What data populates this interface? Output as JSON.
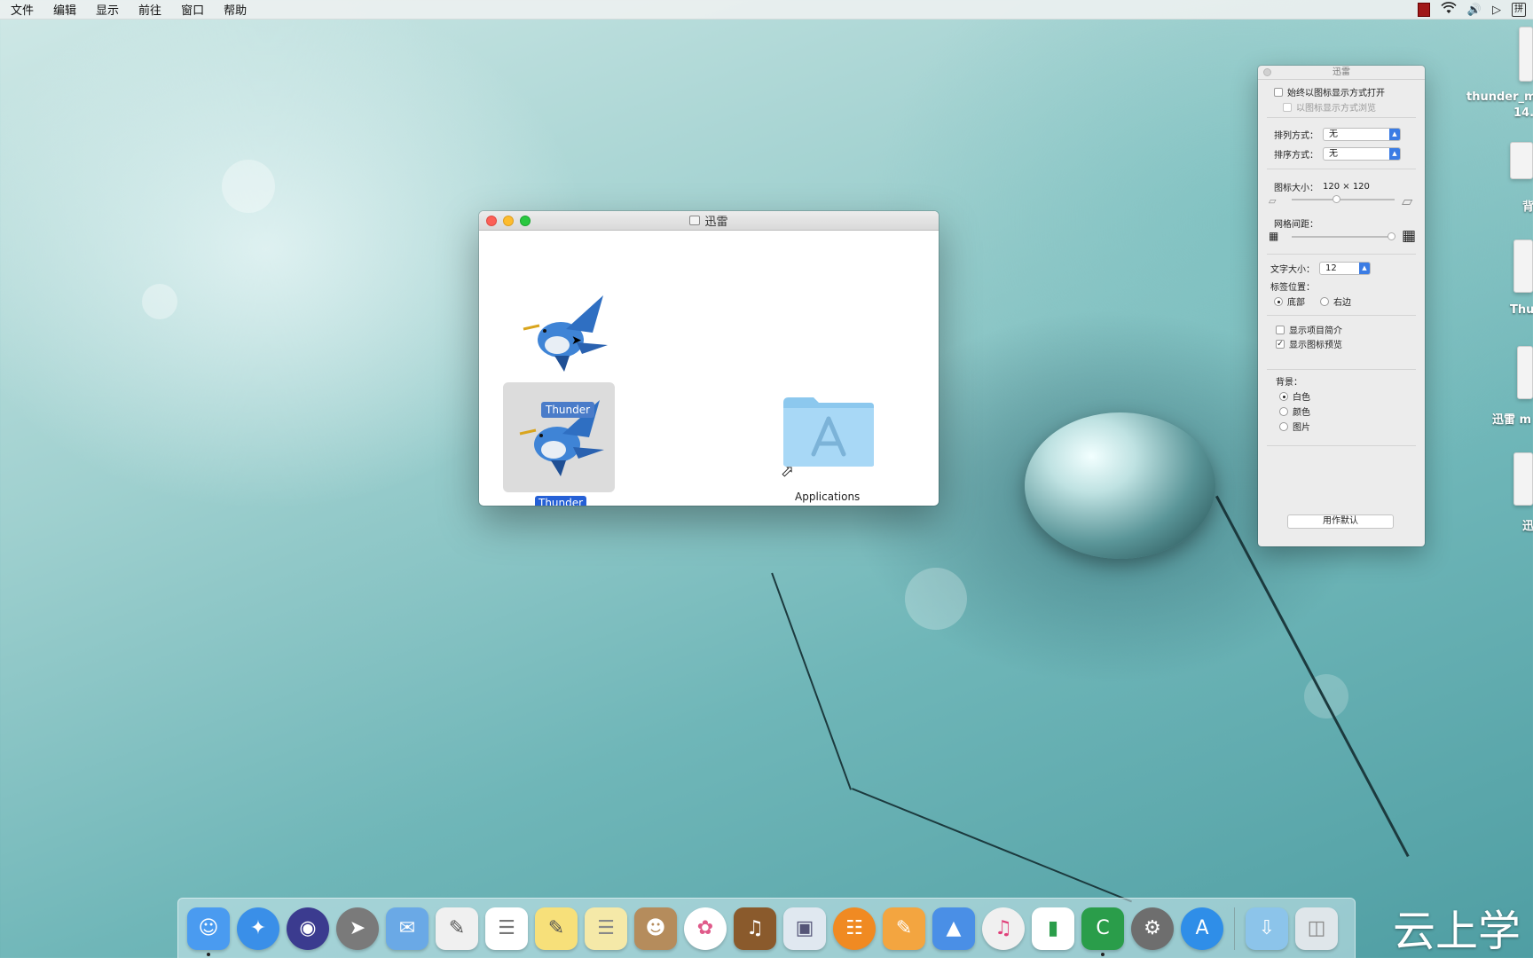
{
  "menubar": {
    "items": [
      "文件",
      "编辑",
      "显示",
      "前往",
      "窗口",
      "帮助"
    ],
    "ime": "拼"
  },
  "finder_window": {
    "title": "迅雷",
    "icons": {
      "thunder_badge": "Thunder",
      "thunder_label": "Thunder",
      "applications_label": "Applications"
    }
  },
  "view_options": {
    "title": "迅雷",
    "always_open_icon_view": {
      "label": "始终以图标显示方式打开",
      "checked": false
    },
    "browse_icon_view": {
      "label": "以图标显示方式浏览",
      "checked": false
    },
    "arrange_by": {
      "label": "排列方式：",
      "value": "无"
    },
    "sort_by": {
      "label": "排序方式：",
      "value": "无"
    },
    "icon_size": {
      "label": "图标大小：",
      "value": "120 × 120"
    },
    "grid_spacing": {
      "label": "网格间距："
    },
    "text_size": {
      "label": "文字大小：",
      "value": "12"
    },
    "label_position": {
      "label": "标签位置：",
      "options": [
        "底部",
        "右边"
      ],
      "selected": "底部"
    },
    "show_item_info": {
      "label": "显示项目简介",
      "checked": false
    },
    "show_icon_preview": {
      "label": "显示图标预览",
      "checked": true
    },
    "background": {
      "label": "背景：",
      "options": [
        "白色",
        "颜色",
        "图片"
      ],
      "selected": "白色"
    },
    "use_as_defaults": "用作默认"
  },
  "desktop_icons": [
    {
      "label": "thunder_m",
      "label2": "14."
    },
    {
      "label": "背"
    },
    {
      "label": "Thu"
    },
    {
      "label": "迅雷 m"
    },
    {
      "label": "迅"
    }
  ],
  "dock": {
    "items": [
      {
        "name": "finder-icon",
        "color": "#4a9bf0",
        "running": true
      },
      {
        "name": "safari-icon",
        "color": "#3a8fe8"
      },
      {
        "name": "siri-icon",
        "color": "#3b3b8f"
      },
      {
        "name": "launchpad-icon",
        "color": "#7a7a7a"
      },
      {
        "name": "mail-icon",
        "color": "#6aa9e6"
      },
      {
        "name": "textedit-icon",
        "color": "#f0f0f0"
      },
      {
        "name": "reminders-icon",
        "color": "#ffffff"
      },
      {
        "name": "stickies-icon",
        "color": "#f7e07a"
      },
      {
        "name": "notes-icon",
        "color": "#f5e9a8"
      },
      {
        "name": "contacts-icon",
        "color": "#b58c5c"
      },
      {
        "name": "photos-icon",
        "color": "#ffffff"
      },
      {
        "name": "garageband-icon",
        "color": "#8a5a2c"
      },
      {
        "name": "preview-icon",
        "color": "#e0e8f0"
      },
      {
        "name": "ibooks-icon",
        "color": "#f08a22"
      },
      {
        "name": "pages-icon",
        "color": "#f3a540"
      },
      {
        "name": "keynote-icon",
        "color": "#4a8fe6"
      },
      {
        "name": "itunes-icon",
        "color": "#f0f0f0"
      },
      {
        "name": "numbers-icon",
        "color": "#ffffff"
      },
      {
        "name": "camtasia-icon",
        "color": "#2a9d4a",
        "running": true
      },
      {
        "name": "system-preferences-icon",
        "color": "#6e6e6e"
      },
      {
        "name": "app-store-icon",
        "color": "#2f8ee8"
      },
      {
        "name": "downloads-folder-icon",
        "color": "#8cc4ea"
      },
      {
        "name": "trash-icon",
        "color": "#dfe6ea"
      }
    ]
  },
  "watermark": "云上学"
}
